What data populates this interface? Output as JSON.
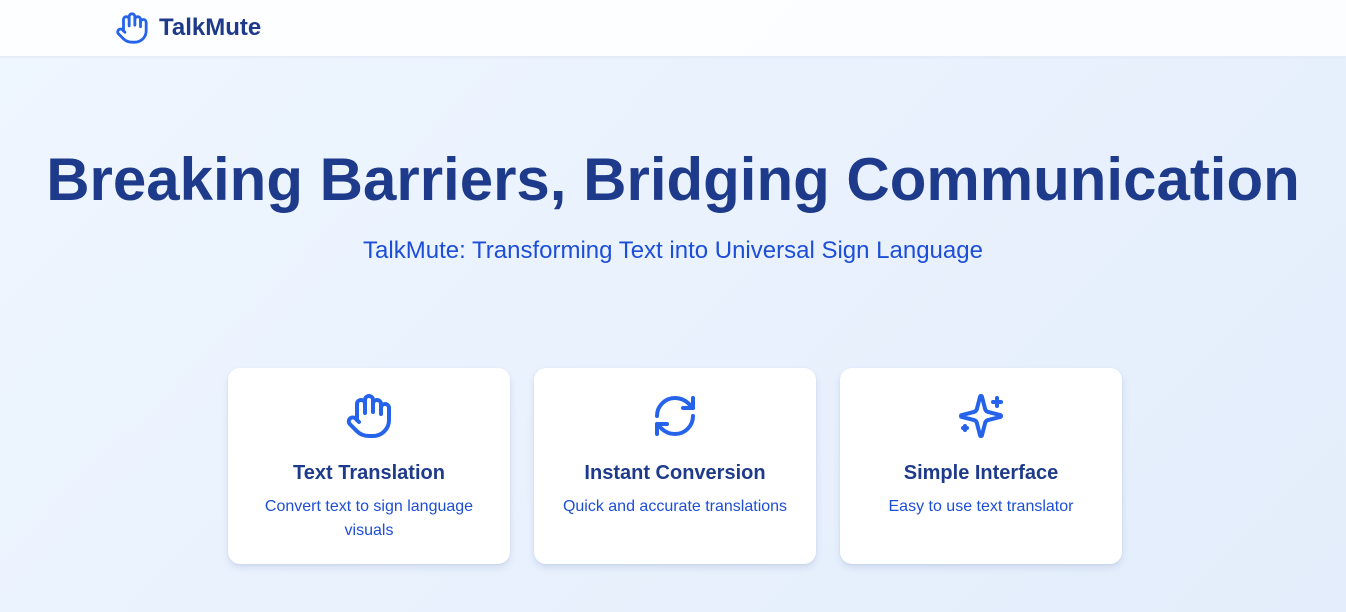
{
  "nav": {
    "brand_name": "TalkMute",
    "brand_icon": "hand-icon"
  },
  "hero": {
    "title": "Breaking Barriers, Bridging Communication",
    "subtitle": "TalkMute: Transforming Text into Universal Sign Language"
  },
  "features": [
    {
      "icon": "hand-icon",
      "title": "Text Translation",
      "description": "Convert text to sign language visuals"
    },
    {
      "icon": "refresh-icon",
      "title": "Instant Conversion",
      "description": "Quick and accurate translations"
    },
    {
      "icon": "sparkles-icon",
      "title": "Simple Interface",
      "description": "Easy to use text translator"
    }
  ],
  "colors": {
    "primary": "#2563eb",
    "heading": "#1e3a8a",
    "text": "#1d4ed8",
    "background": "#eff6ff"
  }
}
